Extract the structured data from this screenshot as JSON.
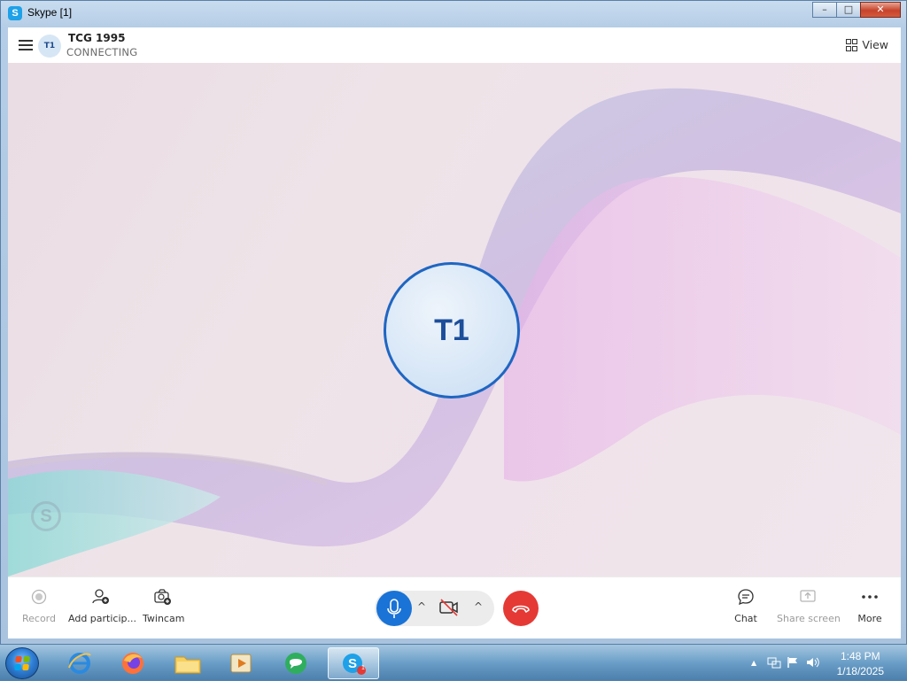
{
  "window": {
    "title": "Skype [1]",
    "app_icon_letter": "S",
    "minimize": "–",
    "maximize": "□",
    "close": "✕"
  },
  "header": {
    "contact_initials": "T1",
    "contact_name": "TCG 1995",
    "status": "CONNECTING",
    "view_label": "View"
  },
  "stage": {
    "avatar_initials": "T1",
    "watermark_letter": "S"
  },
  "controls": {
    "record_label": "Record",
    "add_participants_label": "Add particip...",
    "twincam_label": "Twincam",
    "chat_label": "Chat",
    "share_screen_label": "Share screen",
    "more_label": "More",
    "caret": "^"
  },
  "taskbar": {
    "time": "1:48 PM",
    "date": "1/18/2025",
    "skype_badge": "1",
    "tray_up": "▲"
  },
  "colors": {
    "accent": "#1a73d6",
    "end_call": "#e53935",
    "avatar_border": "#1f66c2"
  }
}
